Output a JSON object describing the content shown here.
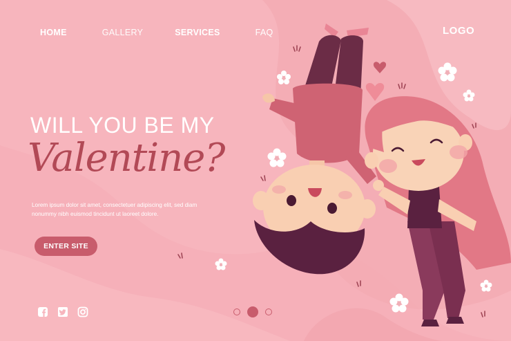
{
  "nav": {
    "home": "HOME",
    "gallery": "GALLERY",
    "services": "SERVICES",
    "faq": "FAQ"
  },
  "logo": "LOGO",
  "hero": {
    "headline": "WILL YOU BE MY",
    "script_title": "Valentine?",
    "body": "Lorem ipsum dolor sit amet, consectetuer adipiscing elit, sed diam nonummy nibh euismod tincidunt ut laoreet dolore.",
    "cta_label": "ENTER SITE"
  },
  "social": [
    "facebook-icon",
    "twitter-icon",
    "instagram-icon"
  ],
  "carousel": {
    "count": 3,
    "active": 2
  },
  "colors": {
    "background": "#f7b5bd",
    "accent": "#c85c6c",
    "script": "#b24956"
  }
}
